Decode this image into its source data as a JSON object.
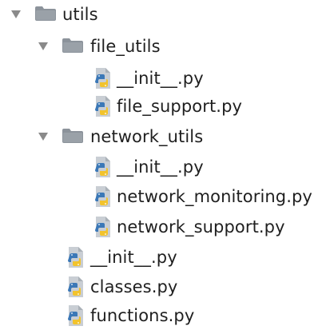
{
  "tree": {
    "root": {
      "label": "utils",
      "expanded": true,
      "icon": "folder-icon",
      "children": {
        "file_utils": {
          "label": "file_utils",
          "expanded": true,
          "icon": "folder-icon",
          "files": [
            {
              "label": "__init__.py",
              "icon": "python-file-icon"
            },
            {
              "label": "file_support.py",
              "icon": "python-file-icon"
            }
          ]
        },
        "network_utils": {
          "label": "network_utils",
          "expanded": true,
          "icon": "folder-icon",
          "files": [
            {
              "label": "__init__.py",
              "icon": "python-file-icon"
            },
            {
              "label": "network_monitoring.py",
              "icon": "python-file-icon"
            },
            {
              "label": "network_support.py",
              "icon": "python-file-icon"
            }
          ]
        },
        "files": [
          {
            "label": "__init__.py",
            "icon": "python-file-icon"
          },
          {
            "label": "classes.py",
            "icon": "python-file-icon"
          },
          {
            "label": "functions.py",
            "icon": "python-file-icon"
          }
        ]
      }
    }
  },
  "colors": {
    "text": "#1f1f1f",
    "chevron": "#8a8a8a",
    "folder": "#8c939b",
    "python_blue": "#3b78b7",
    "python_yellow": "#f2c32c",
    "file_page": "#c9ced4"
  }
}
